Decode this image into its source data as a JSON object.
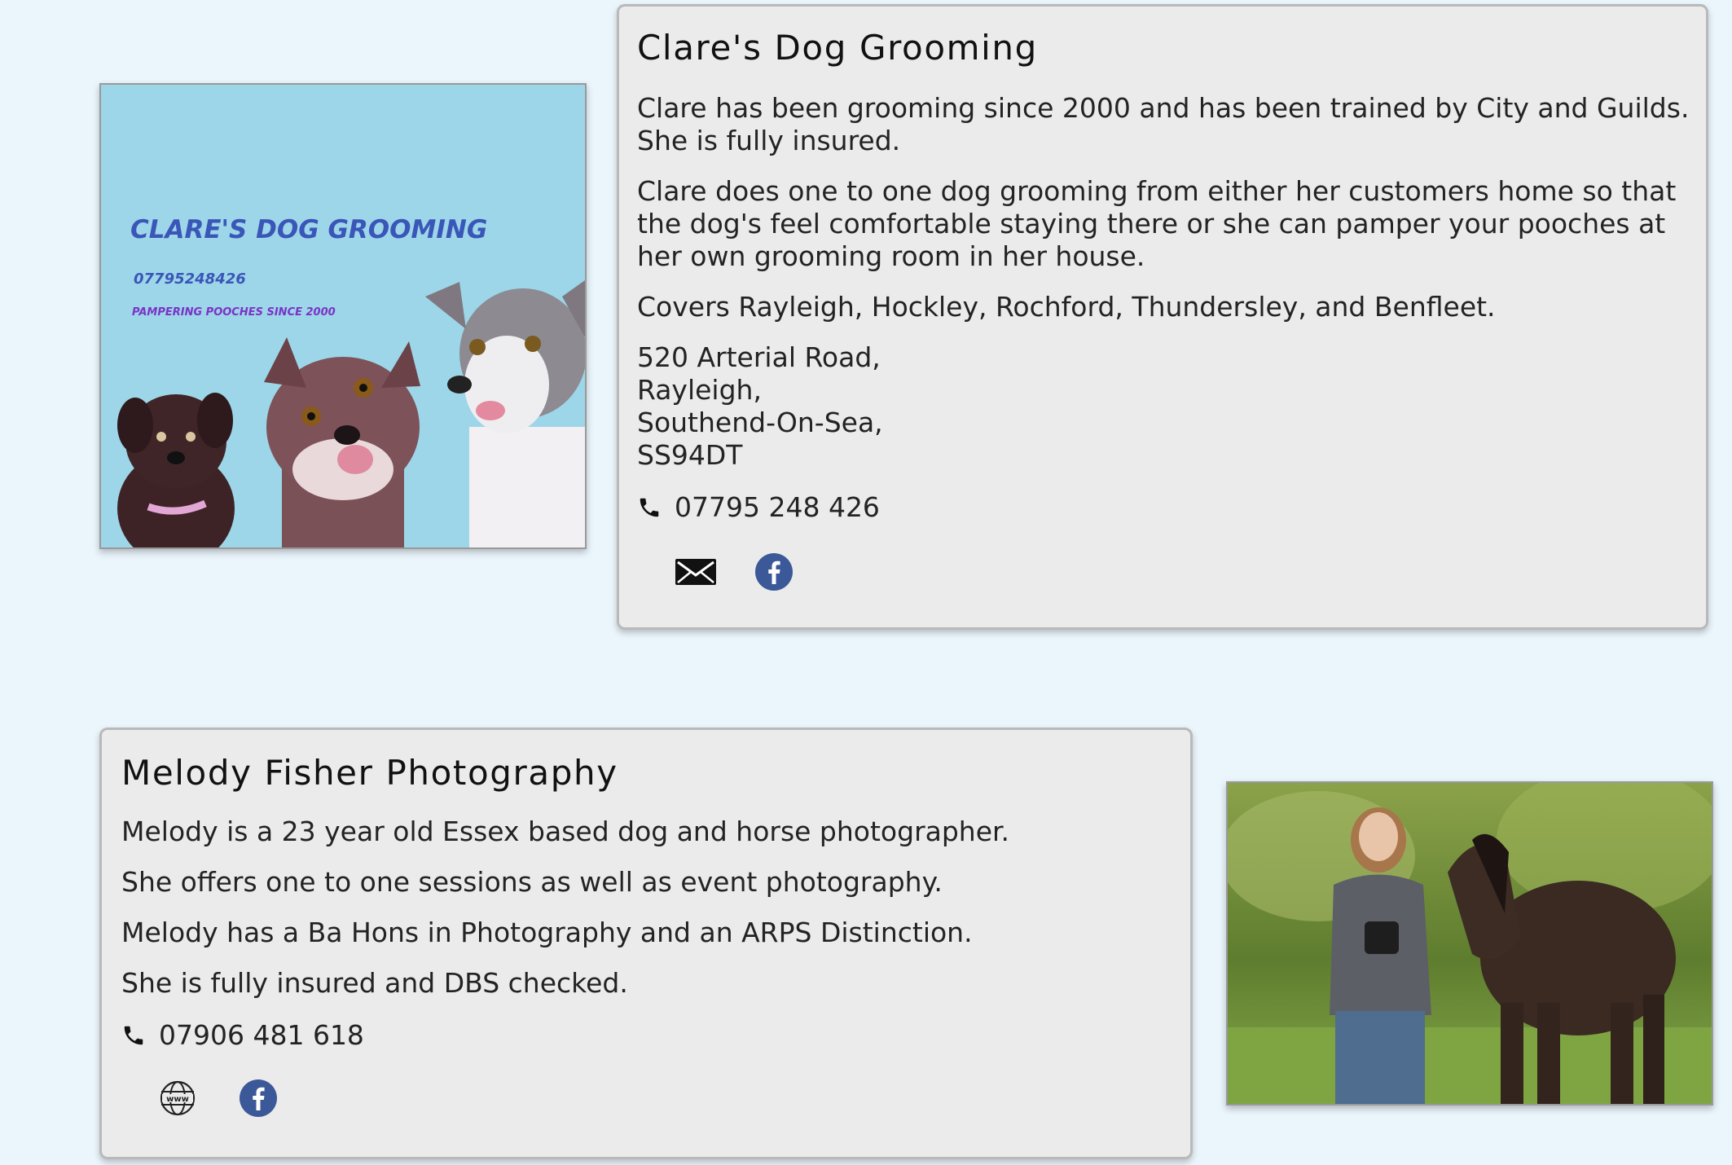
{
  "listings": [
    {
      "title": "Clare's Dog Grooming",
      "paragraphs": [
        "Clare has been grooming since 2000 and has been trained by City and Guilds. She is fully insured.",
        "Clare does one to one dog grooming from either her customers home so that the dog's feel comfortable staying there or she can pamper your pooches at her own grooming room in her house.",
        "Covers Rayleigh, Hockley, Rochford, Thundersley, and Benfleet."
      ],
      "address": [
        "520 Arterial Road,",
        "Rayleigh,",
        "Southend-On-Sea,",
        "SS94DT"
      ],
      "phone": "07795 248 426",
      "logo": {
        "title": "CLARE'S DOG GROOMING",
        "phone": "07795248426",
        "tagline": "PAMPERING POOCHES SINCE 2000"
      }
    },
    {
      "title": "Melody Fisher Photography",
      "paragraphs": [
        "Melody is a 23 year old Essex based dog and horse photographer.",
        "She offers one to one sessions as well as event photography.",
        "Melody has a Ba Hons in Photography and an ARPS Distinction.",
        "She is fully insured and DBS checked."
      ],
      "phone": "07906 481 618"
    }
  ],
  "icons": {
    "phone": "phone-icon",
    "email": "envelope-icon",
    "facebook": "facebook-icon",
    "website": "globe-www-icon"
  },
  "colors": {
    "page_bg": "#eaf5fc",
    "card_bg": "#ebebeb",
    "facebook_blue": "#3b5998",
    "logo_bg": "#9dd6e8",
    "logo_title": "#3a56b8"
  }
}
